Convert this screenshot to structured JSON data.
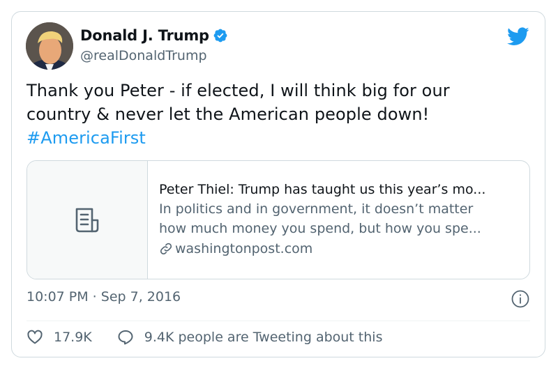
{
  "tweet": {
    "author": {
      "name": "Donald J. Trump",
      "handle": "@realDonaldTrump",
      "verified": true
    },
    "text_line1": "Thank you Peter - if elected, I will think big for our",
    "text_line2": "country & never let the American people down!",
    "hashtag": "#AmericaFirst",
    "link_card": {
      "title": "Peter Thiel: Trump has taught us this year’s mo...",
      "description_line1": "In politics and in government, it doesn’t matter",
      "description_line2": "how much money you spend, but how you spe...",
      "domain": "washingtonpost.com",
      "thumbnail_icon": "article-icon"
    },
    "timestamp": "10:07 PM · Sep 7, 2016",
    "likes": "17.9K",
    "reply_text": "9.4K people are Tweeting about this"
  },
  "colors": {
    "accent": "#1d9bf0",
    "text": "#0f1419",
    "secondary": "#536471",
    "border": "#cfd9de"
  },
  "icons": [
    "verified-badge-icon",
    "twitter-bird-icon",
    "article-icon",
    "link-icon",
    "info-icon",
    "heart-icon",
    "reply-icon"
  ]
}
